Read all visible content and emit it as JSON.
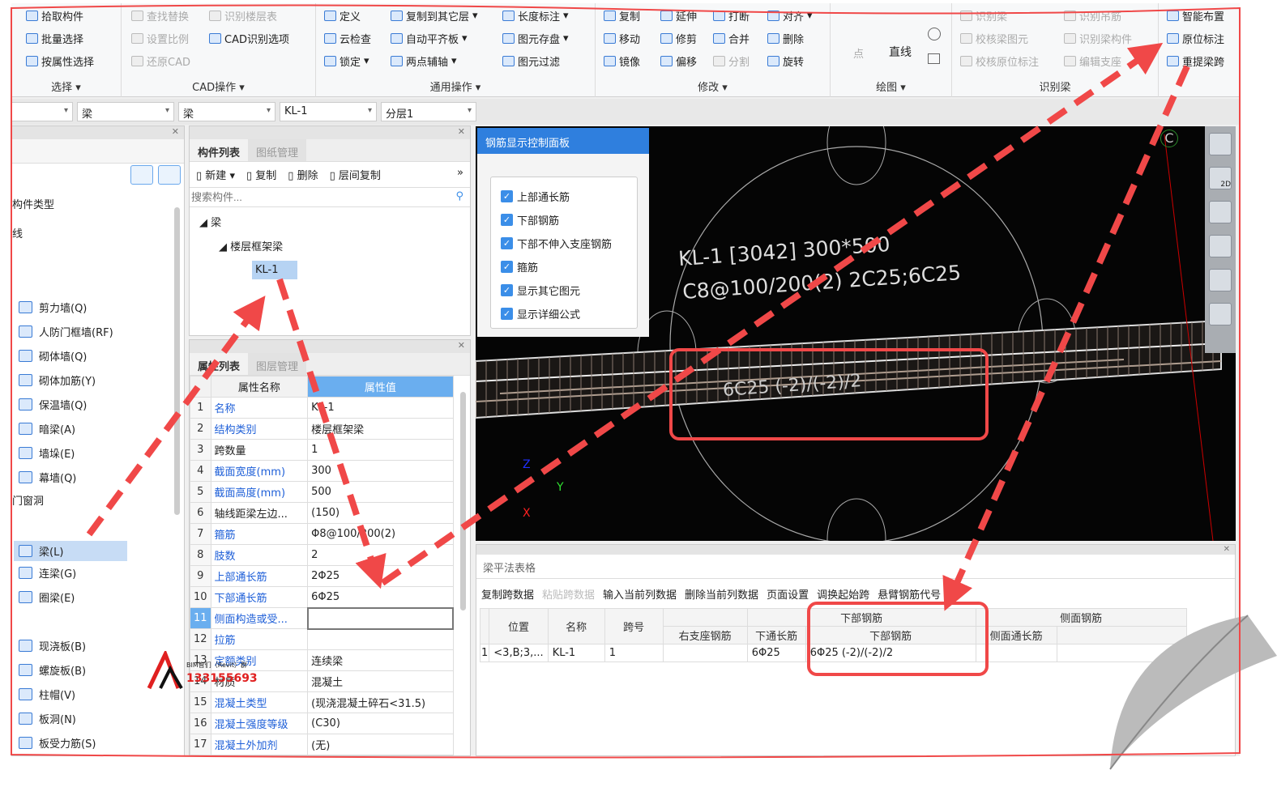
{
  "ribbon": {
    "groups": [
      {
        "label": "选择",
        "items": [
          "拾取构件",
          "批量选择",
          "按属性选择"
        ]
      },
      {
        "label": "CAD操作",
        "items": [
          "查找替换",
          "识别楼层表",
          "设置比例",
          "CAD识别选项",
          "还原CAD"
        ]
      },
      {
        "label": "通用操作",
        "items": [
          "定义",
          "复制到其它层",
          "长度标注",
          "云检查",
          "自动平齐板",
          "图元存盘",
          "锁定",
          "两点辅轴",
          "图元过滤"
        ]
      },
      {
        "label": "修改",
        "items": [
          "复制",
          "延伸",
          "打断",
          "对齐",
          "移动",
          "修剪",
          "合并",
          "删除",
          "镜像",
          "偏移",
          "分割",
          "旋转"
        ]
      },
      {
        "label": "绘图",
        "items": [
          "点",
          "直线"
        ]
      },
      {
        "label": "识别梁",
        "items": [
          "识别梁",
          "识别吊筋",
          "校核梁图元",
          "识别梁构件",
          "校核原位标注",
          "编辑支座"
        ]
      },
      {
        "label": "",
        "items": [
          "智能布置",
          "原位标注",
          "重提梁跨"
        ]
      }
    ]
  },
  "selectors": [
    "",
    "梁",
    "梁",
    "KL-1",
    "分层1"
  ],
  "left_panel": {
    "header": "构件类型",
    "items": [
      "线",
      "剪力墙(Q)",
      "人防门框墙(RF)",
      "砌体墙(Q)",
      "砌体加筋(Y)",
      "保温墙(Q)",
      "暗梁(A)",
      "墙垛(E)",
      "幕墙(Q)",
      "门窗洞",
      "梁(L)",
      "连梁(G)",
      "圈梁(E)",
      "现浇板(B)",
      "螺旋板(B)",
      "柱帽(V)",
      "板洞(N)",
      "板受力筋(S)"
    ],
    "selected": "梁(L)"
  },
  "component_list": {
    "tabs": [
      "构件列表",
      "图纸管理"
    ],
    "toolbar": [
      "新建",
      "复制",
      "删除",
      "层间复制"
    ],
    "search_placeholder": "搜索构件...",
    "tree": {
      "root": "梁",
      "child": "楼层框架梁",
      "leaf": "KL-1"
    }
  },
  "properties": {
    "tabs": [
      "属性列表",
      "图层管理"
    ],
    "headers": [
      "属性名称",
      "属性值"
    ],
    "rows": [
      {
        "n": "1",
        "name": "名称",
        "value": "KL-1",
        "blue": true
      },
      {
        "n": "2",
        "name": "结构类别",
        "value": "楼层框架梁",
        "blue": true
      },
      {
        "n": "3",
        "name": "跨数量",
        "value": "1",
        "blue": false
      },
      {
        "n": "4",
        "name": "截面宽度(mm)",
        "value": "300",
        "blue": true
      },
      {
        "n": "5",
        "name": "截面高度(mm)",
        "value": "500",
        "blue": true
      },
      {
        "n": "6",
        "name": "轴线距梁左边...",
        "value": "(150)",
        "blue": false
      },
      {
        "n": "7",
        "name": "箍筋",
        "value": "Φ8@100/200(2)",
        "blue": true
      },
      {
        "n": "8",
        "name": "肢数",
        "value": "2",
        "blue": true
      },
      {
        "n": "9",
        "name": "上部通长筋",
        "value": "2Φ25",
        "blue": true
      },
      {
        "n": "10",
        "name": "下部通长筋",
        "value": "6Φ25",
        "blue": true
      },
      {
        "n": "11",
        "name": "侧面构造或受...",
        "value": "",
        "blue": true
      },
      {
        "n": "12",
        "name": "拉筋",
        "value": "",
        "blue": true
      },
      {
        "n": "13",
        "name": "定额类别",
        "value": "连续梁",
        "blue": true
      },
      {
        "n": "14",
        "name": "材质",
        "value": "混凝土",
        "blue": false
      },
      {
        "n": "15",
        "name": "混凝土类型",
        "value": "(现浇混凝土碎石<31.5)",
        "blue": true
      },
      {
        "n": "16",
        "name": "混凝土强度等级",
        "value": "(C30)",
        "blue": true
      },
      {
        "n": "17",
        "name": "混凝土外加剂",
        "value": "(无)",
        "blue": true
      }
    ]
  },
  "watermark": {
    "line1": "BIM智们（Revit）群",
    "line2": "133155693"
  },
  "rebar_panel": {
    "title": "钢筋显示控制面板",
    "options": [
      {
        "label": "上部通长筋",
        "checked": true
      },
      {
        "label": "下部钢筋",
        "checked": true
      },
      {
        "label": "下部不伸入支座钢筋",
        "checked": true
      },
      {
        "label": "箍筋",
        "checked": true
      },
      {
        "label": "显示其它图元",
        "checked": true
      },
      {
        "label": "显示详细公式",
        "checked": true
      }
    ]
  },
  "viewport": {
    "label_line1": "KL-1 [3042] 300*500",
    "label_line2": "C8@100/200(2) 2C25;6C25",
    "bottom_label": "6C25 (-2)/(-2)/2",
    "axes": [
      "Z",
      "Y",
      "X"
    ],
    "corner": "C",
    "view_2d": "2D"
  },
  "beam_table": {
    "title": "梁平法表格",
    "toolbar": [
      {
        "label": "复制跨数据",
        "enabled": true
      },
      {
        "label": "粘贴跨数据",
        "enabled": false
      },
      {
        "label": "输入当前列数据",
        "enabled": true
      },
      {
        "label": "删除当前列数据",
        "enabled": true
      },
      {
        "label": "页面设置",
        "enabled": true
      },
      {
        "label": "调换起始跨",
        "enabled": true
      },
      {
        "label": "悬臂钢筋代号",
        "enabled": true
      }
    ],
    "headers": {
      "pos": "位置",
      "name": "名称",
      "span": "跨号",
      "right_support": "右支座钢筋",
      "bottom_group": "下部钢筋",
      "bottom_through": "下通长筋",
      "bottom_rebar": "下部钢筋",
      "side_group": "侧面钢筋",
      "side_through": "侧面通长筋"
    },
    "row": {
      "n": "1",
      "pos": "<3,B;3,...",
      "name": "KL-1",
      "span": "1",
      "right_support": "",
      "bottom_through": "6Φ25",
      "bottom_rebar": "6Φ25 (-2)/(-2)/2",
      "side_through": ""
    }
  },
  "colors": {
    "annotation": "#f04848",
    "accent": "#2f7fde",
    "link": "#1e5fd8"
  }
}
